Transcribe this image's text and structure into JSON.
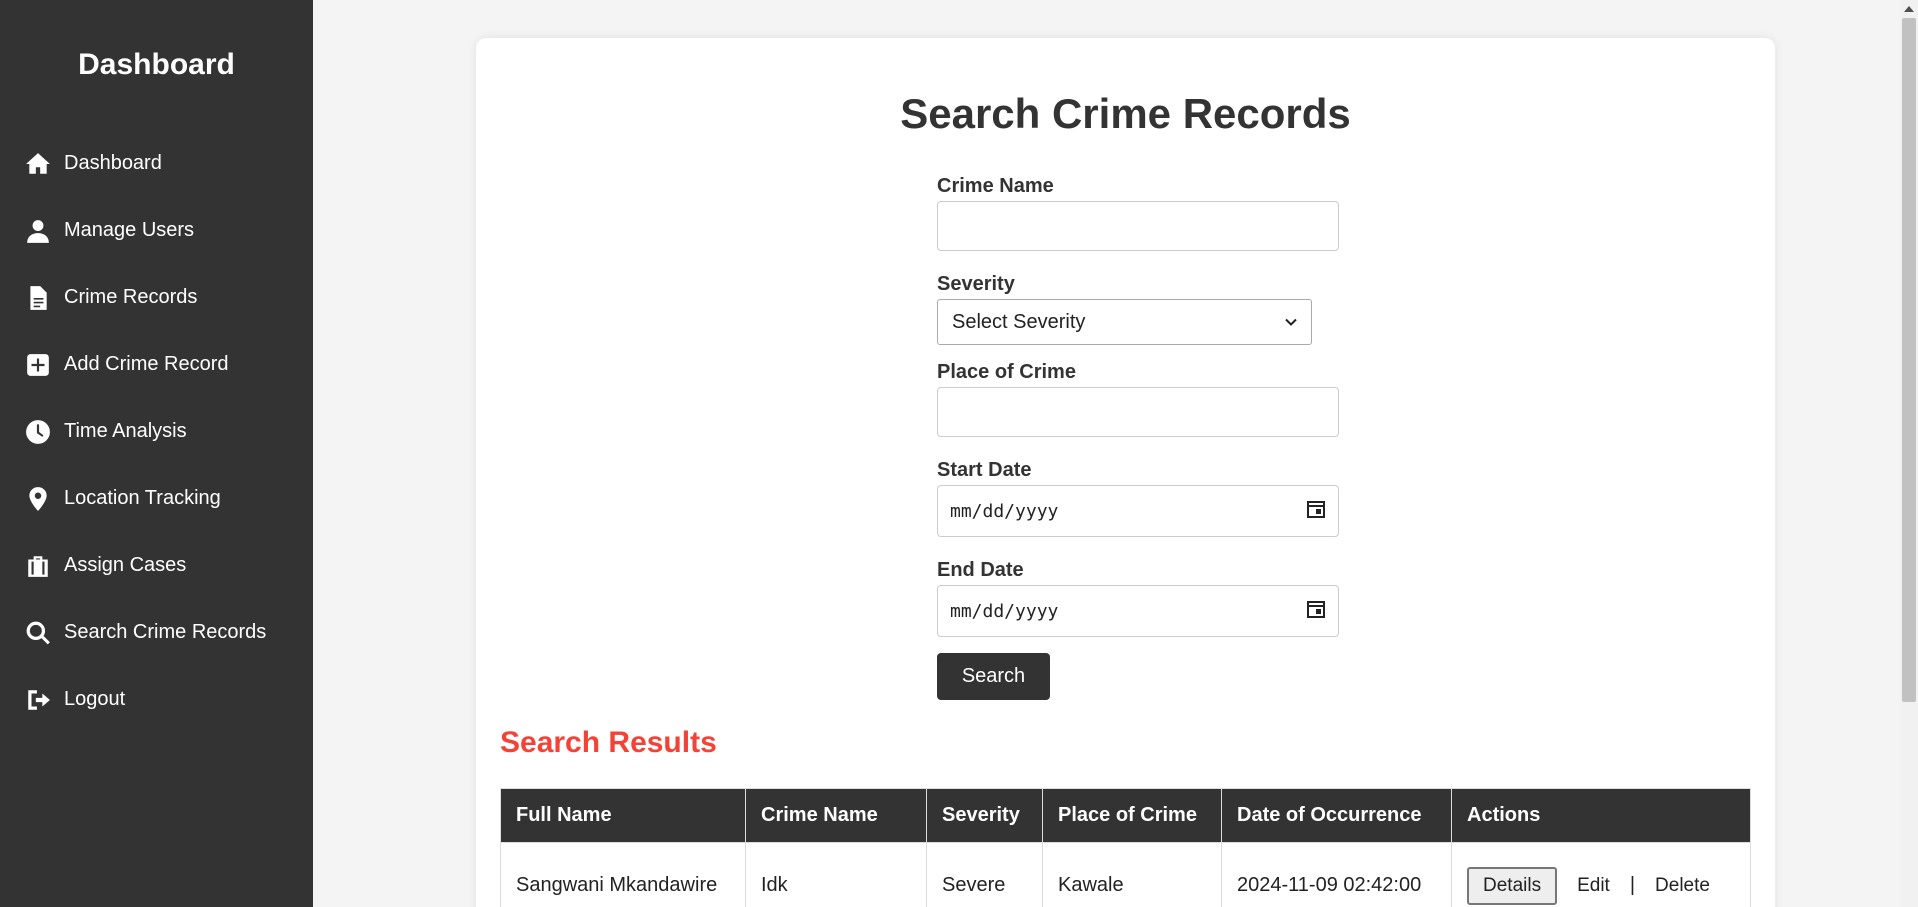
{
  "sidebar": {
    "brand": "Dashboard",
    "items": [
      {
        "label": "Dashboard",
        "icon": "home-icon"
      },
      {
        "label": "Manage Users",
        "icon": "user-icon"
      },
      {
        "label": "Crime Records",
        "icon": "file-icon"
      },
      {
        "label": "Add Crime Record",
        "icon": "plus-square-icon"
      },
      {
        "label": "Time Analysis",
        "icon": "clock-icon"
      },
      {
        "label": "Location Tracking",
        "icon": "map-pin-icon"
      },
      {
        "label": "Assign Cases",
        "icon": "briefcase-icon"
      },
      {
        "label": "Search Crime Records",
        "icon": "search-icon"
      },
      {
        "label": "Logout",
        "icon": "logout-icon"
      }
    ]
  },
  "main": {
    "title": "Search Crime Records",
    "form": {
      "crime_name_label": "Crime Name",
      "crime_name_value": "",
      "severity_label": "Severity",
      "severity_selected": "Select Severity",
      "place_label": "Place of Crime",
      "place_value": "",
      "start_date_label": "Start Date",
      "start_date_placeholder": "mm/dd/yyyy",
      "end_date_label": "End Date",
      "end_date_placeholder": "mm/dd/yyyy",
      "search_button": "Search"
    },
    "results": {
      "title": "Search Results",
      "columns": [
        "Full Name",
        "Crime Name",
        "Severity",
        "Place of Crime",
        "Date of Occurrence",
        "Actions"
      ],
      "rows": [
        {
          "full_name": "Sangwani Mkandawire",
          "crime_name": "Idk",
          "severity": "Severe",
          "place": "Kawale",
          "date": "2024-11-09 02:42:00",
          "details_label": "Details",
          "edit_label": "Edit",
          "separator": "|",
          "delete_label": "Delete"
        }
      ]
    }
  },
  "colors": {
    "sidebar_bg": "#333333",
    "page_bg": "#f4f4f4",
    "accent_red": "#f44336",
    "table_header_bg": "#333333"
  }
}
